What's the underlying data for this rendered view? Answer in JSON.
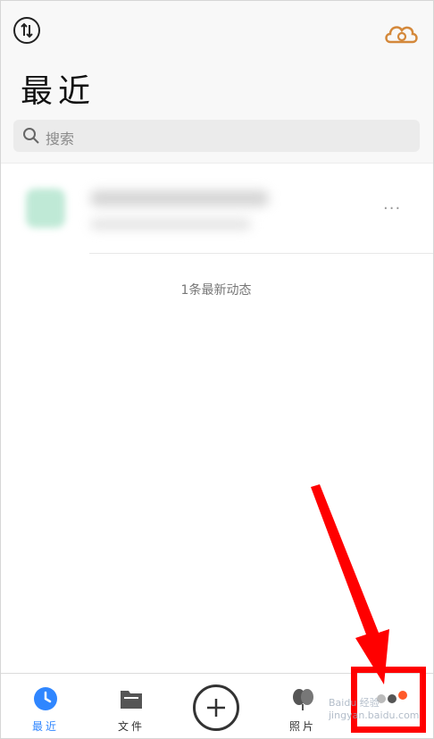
{
  "header": {
    "title": "最近",
    "search": {
      "placeholder": "搜索"
    },
    "icons": {
      "sort": "sort-arrows-icon",
      "cloud": "cloud-icon"
    },
    "accent_color": "#d4883a"
  },
  "list": {
    "items": [
      {
        "status": "blurred",
        "more_label": "···"
      }
    ],
    "footer_text": "1条最新动态"
  },
  "tabbar": {
    "tabs": [
      {
        "label": "最近",
        "icon": "clock-icon",
        "active": true
      },
      {
        "label": "文件",
        "icon": "folder-icon",
        "active": false
      },
      {
        "label": "",
        "icon": "plus-circle-icon",
        "active": false
      },
      {
        "label": "照片",
        "icon": "photos-icon",
        "active": false
      },
      {
        "label": "",
        "icon": "more-dots-icon",
        "active": false
      }
    ],
    "active_color": "#2f86ff"
  },
  "annotation": {
    "highlight_color": "#ff0000",
    "watermark": "Baidu 经验 jingyan.baidu.com"
  }
}
